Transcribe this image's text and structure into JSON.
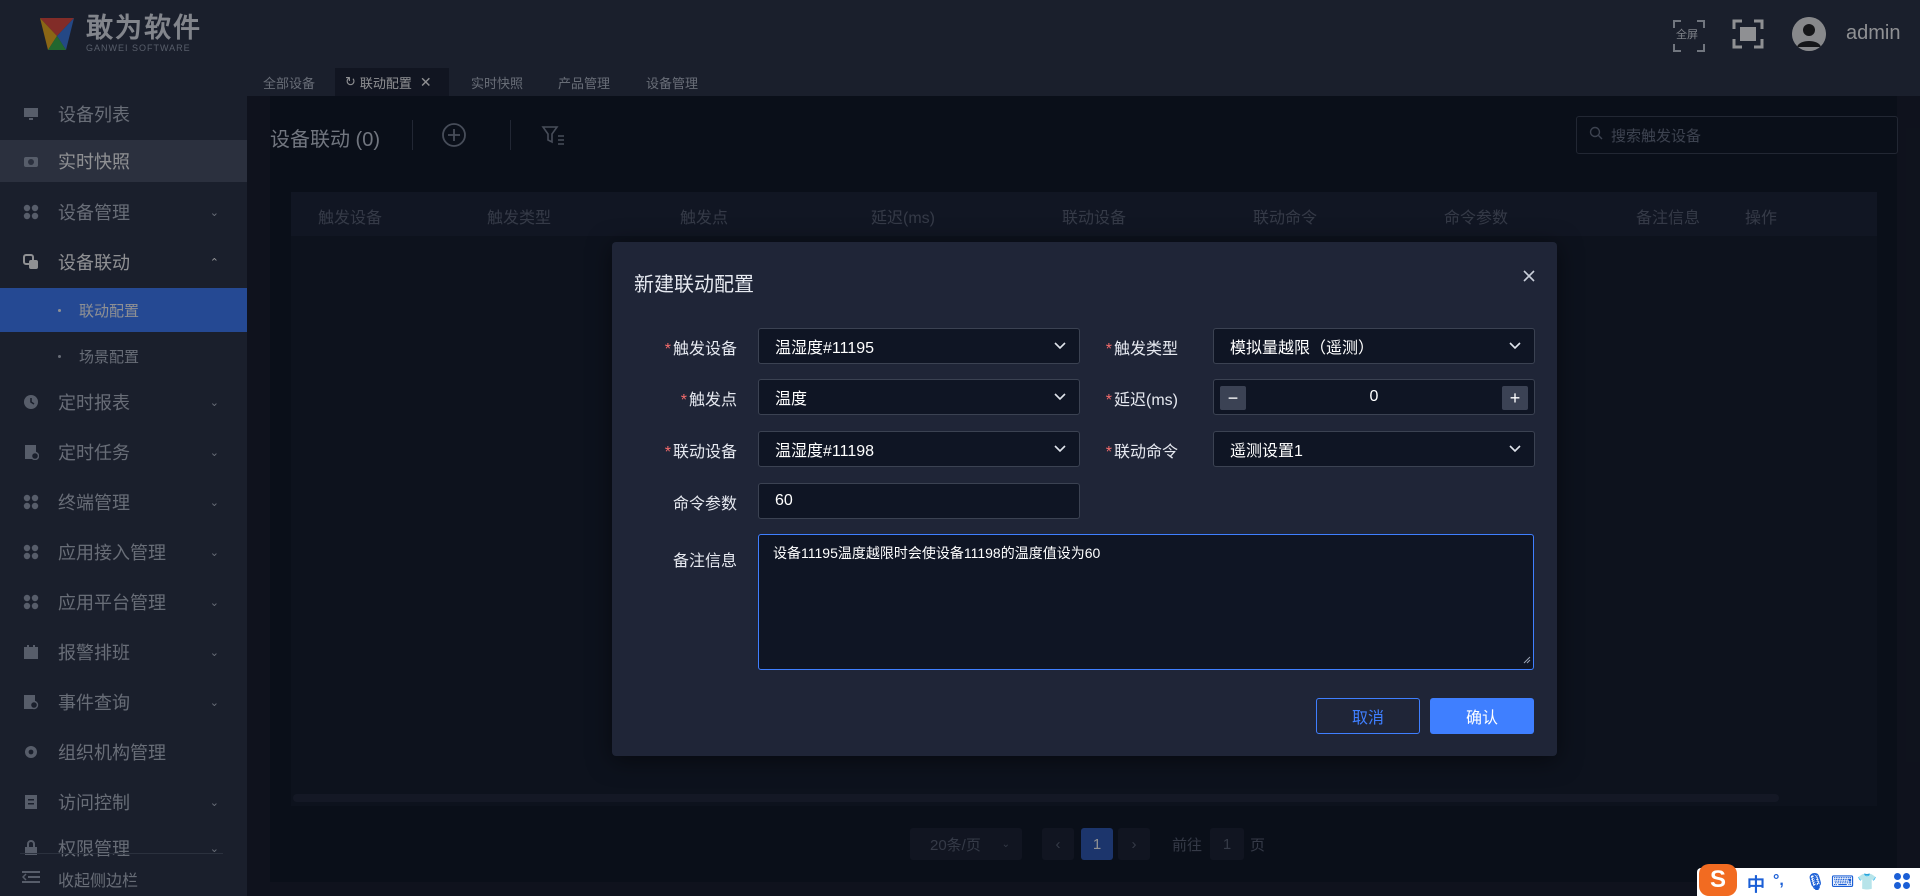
{
  "brand": {
    "name": "敢为软件",
    "sub": "GANWEI SOFTWARE"
  },
  "header": {
    "fullscreen_label": "全屏",
    "user": "admin"
  },
  "sidebar": {
    "items": [
      {
        "label": "设备列表",
        "icon": "monitor-icon"
      },
      {
        "label": "实时快照",
        "icon": "camera-icon"
      },
      {
        "label": "设备管理",
        "icon": "grid-icon"
      },
      {
        "label": "设备联动",
        "icon": "link-icon"
      },
      {
        "label": "定时报表",
        "icon": "clock-icon"
      },
      {
        "label": "定时任务",
        "icon": "task-icon"
      },
      {
        "label": "终端管理",
        "icon": "grid-icon"
      },
      {
        "label": "应用接入管理",
        "icon": "grid-icon"
      },
      {
        "label": "应用平台管理",
        "icon": "grid-icon"
      },
      {
        "label": "报警排班",
        "icon": "calendar-icon"
      },
      {
        "label": "事件查询",
        "icon": "search-doc-icon"
      },
      {
        "label": "组织机构管理",
        "icon": "gear-icon"
      },
      {
        "label": "访问控制",
        "icon": "doc-icon"
      },
      {
        "label": "权限管理",
        "icon": "lock-icon"
      }
    ],
    "sub_items": [
      {
        "label": "联动配置"
      },
      {
        "label": "场景配置"
      }
    ],
    "collapse_label": "收起侧边栏"
  },
  "tabs": [
    {
      "label": "全部设备"
    },
    {
      "label": "联动配置"
    },
    {
      "label": "实时快照"
    },
    {
      "label": "产品管理"
    },
    {
      "label": "设备管理"
    }
  ],
  "main": {
    "title": "设备联动 (0)",
    "search_placeholder": "搜索触发设备",
    "columns": [
      "触发设备",
      "触发类型",
      "触发点",
      "延迟(ms)",
      "联动设备",
      "联动命令",
      "命令参数",
      "备注信息",
      "操作"
    ]
  },
  "pagination": {
    "page_size": "20条/页",
    "current_page": "1",
    "goto_label": "前往",
    "goto_value": "1",
    "page_unit": "页"
  },
  "dialog": {
    "title": "新建联动配置",
    "fields": {
      "trigger_device": {
        "label": "触发设备",
        "value": "温湿度#11195"
      },
      "trigger_type": {
        "label": "触发类型",
        "value": "模拟量越限（遥测）"
      },
      "trigger_point": {
        "label": "触发点",
        "value": "温度"
      },
      "delay": {
        "label": "延迟(ms)",
        "value": "0"
      },
      "linked_device": {
        "label": "联动设备",
        "value": "温湿度#11198"
      },
      "linked_command": {
        "label": "联动命令",
        "value": "遥测设置1"
      },
      "command_param": {
        "label": "命令参数",
        "value": "60"
      },
      "remark": {
        "label": "备注信息",
        "value": "设备11195温度越限时会使设备11198的温度值设为60"
      }
    },
    "cancel_label": "取消",
    "confirm_label": "确认"
  },
  "ime": {
    "mode": "中",
    "punct": "°,",
    "logo": "S"
  },
  "colors": {
    "accent": "#3f7fff",
    "header_bg": "#2b3244",
    "content_bg": "#0d1422",
    "required": "#f56c6c"
  }
}
